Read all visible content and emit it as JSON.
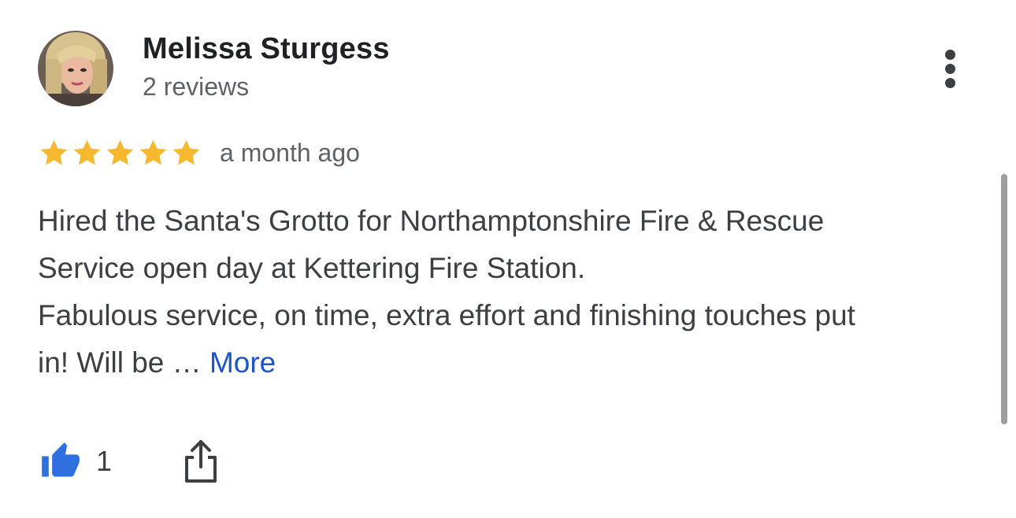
{
  "review": {
    "author": {
      "name": "Melissa Sturgess",
      "reviews_count": "2 reviews",
      "avatar_icon": "profile-photo"
    },
    "rating": 5,
    "rating_max": 5,
    "time": "a month ago",
    "text_lines": [
      "Hired the Santa's Grotto for Northamptonshire Fire & Rescue",
      "Service open day at Kettering Fire Station.",
      "Fabulous service, on time, extra effort and finishing touches put"
    ],
    "text_last_line": "in! Will be … ",
    "more_label": "More",
    "likes": "1"
  },
  "icons": {
    "menu": "more-vert-icon",
    "star": "star-icon",
    "like": "thumb-up-icon",
    "share": "share-icon"
  },
  "colors": {
    "star": "#F5B82E",
    "link": "#1A56C8",
    "like": "#2F6FE0",
    "text_primary": "#202124",
    "text_secondary": "#5F6368"
  }
}
